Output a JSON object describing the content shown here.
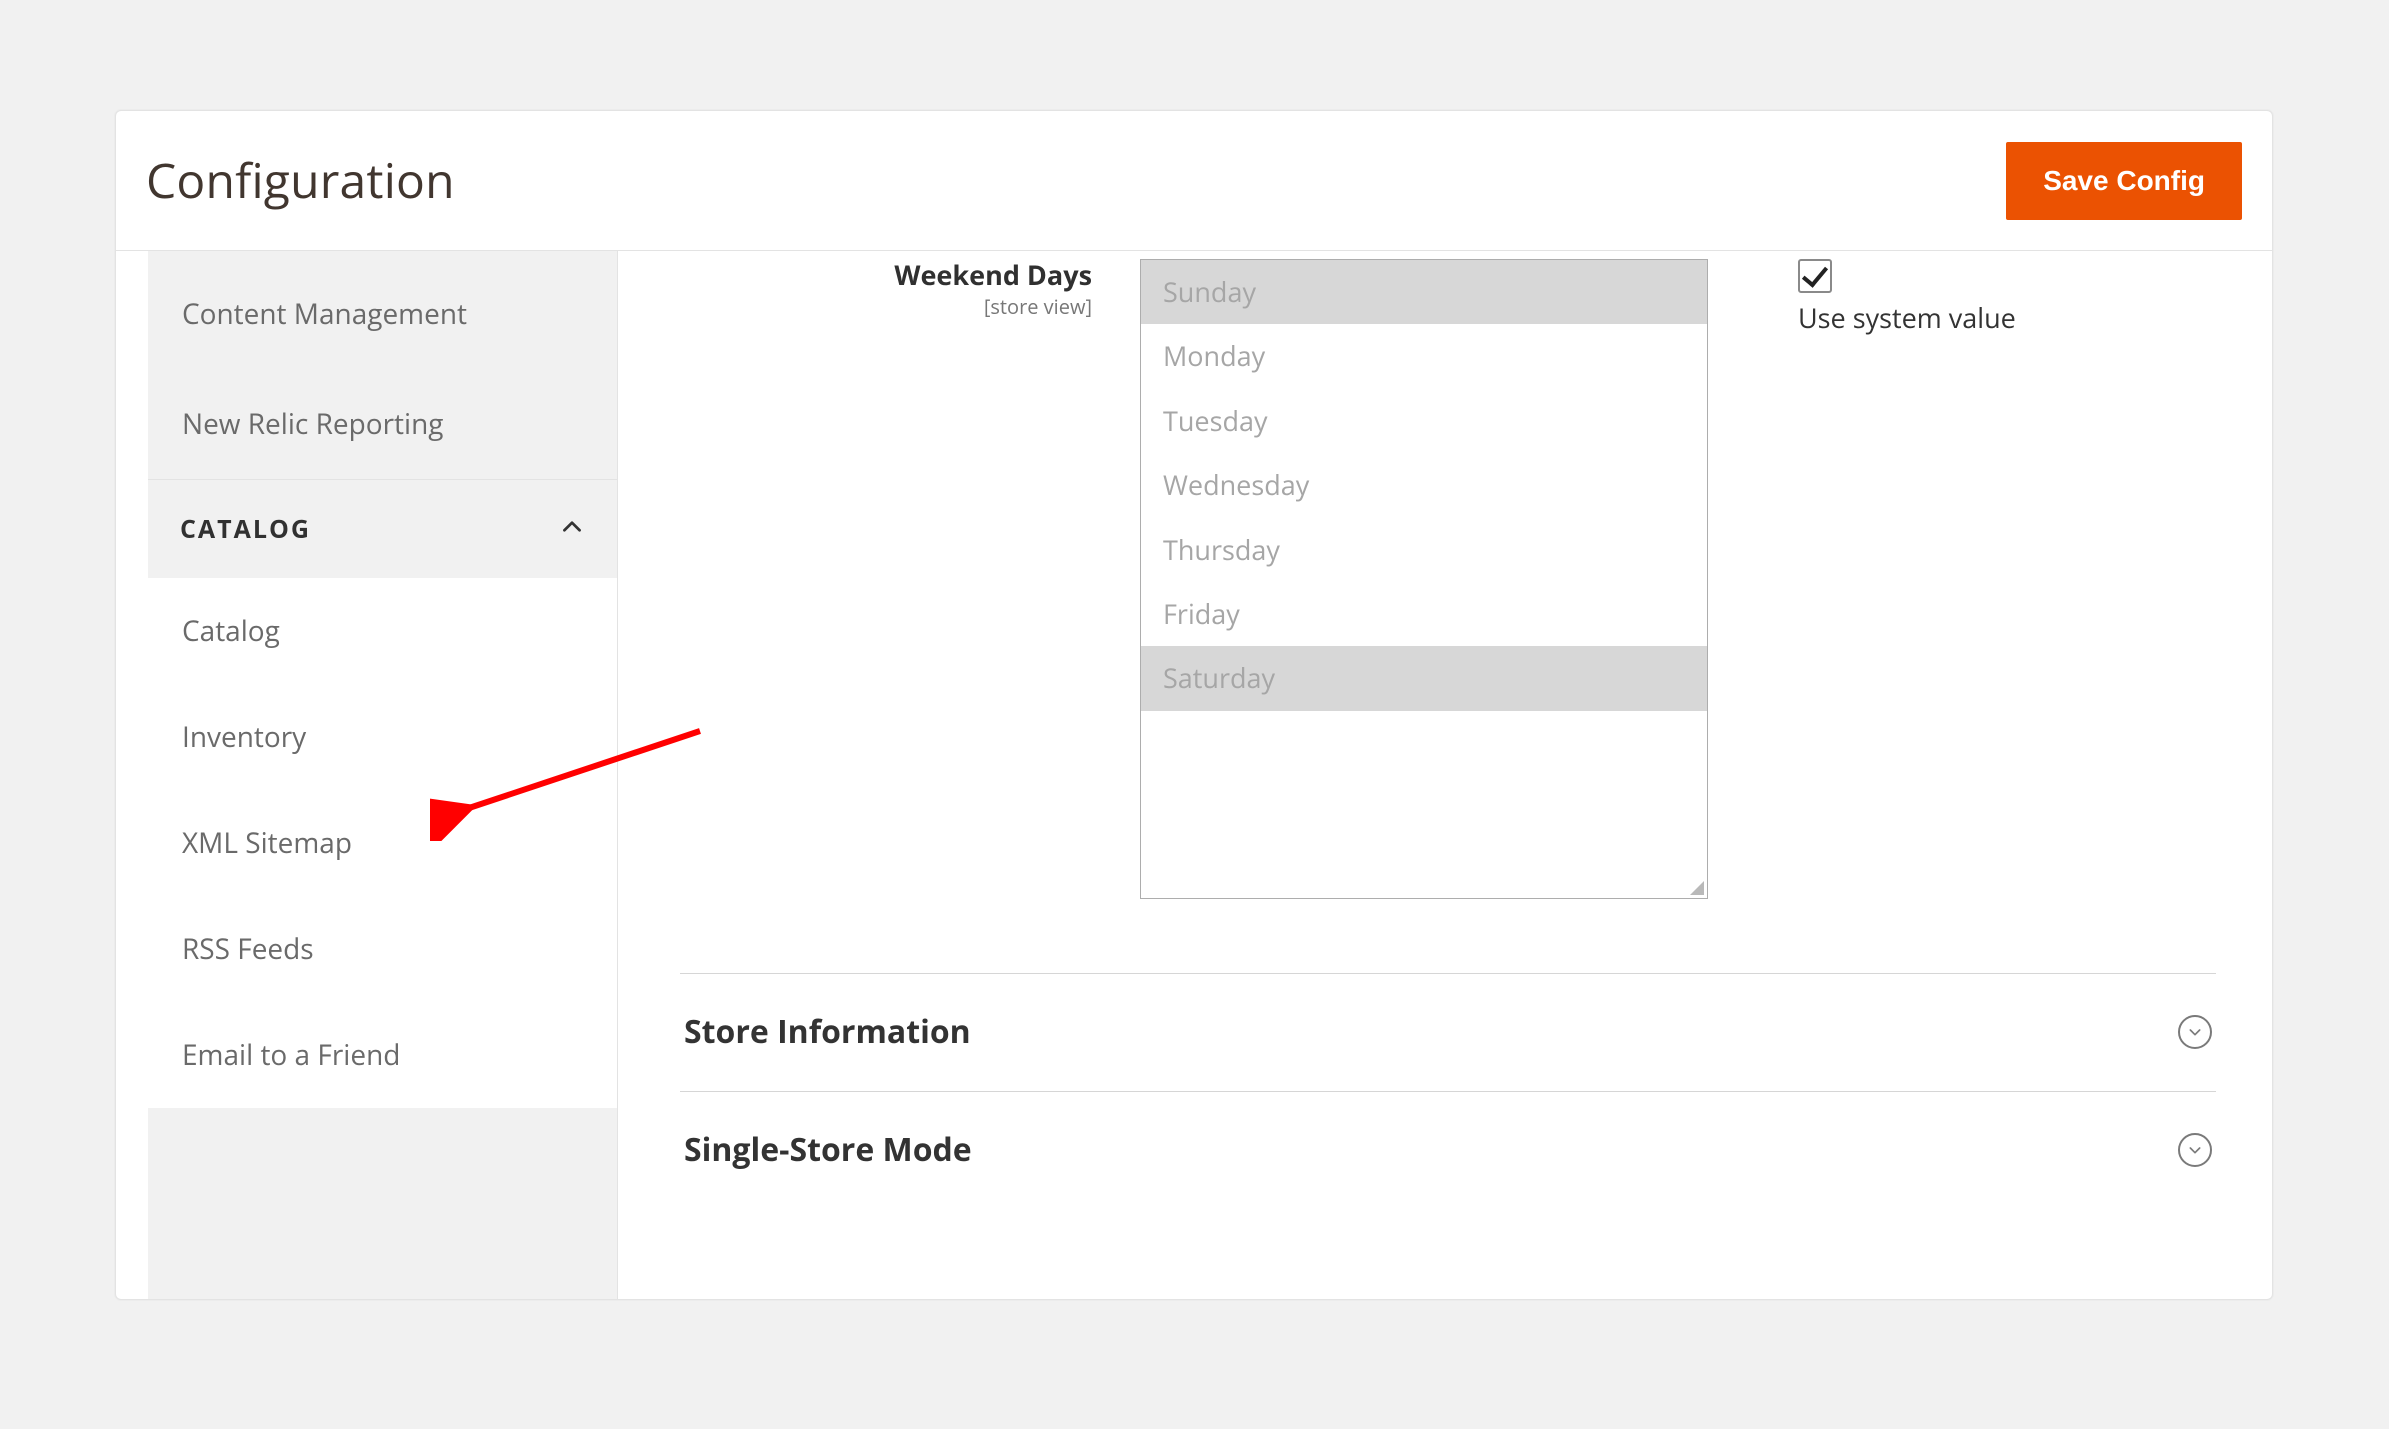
{
  "header": {
    "title": "Configuration",
    "save_label": "Save Config"
  },
  "sidebar": {
    "general_items": [
      {
        "label": "Content Management"
      },
      {
        "label": "New Relic Reporting"
      }
    ],
    "catalog_section": {
      "label": "CATALOG",
      "expanded": true,
      "items": [
        {
          "label": "Catalog"
        },
        {
          "label": "Inventory"
        },
        {
          "label": "XML Sitemap"
        },
        {
          "label": "RSS Feeds"
        },
        {
          "label": "Email to a Friend"
        }
      ]
    }
  },
  "field": {
    "label": "Weekend Days",
    "scope": "[store view]",
    "options": [
      {
        "label": "Sunday",
        "selected": true
      },
      {
        "label": "Monday",
        "selected": false
      },
      {
        "label": "Tuesday",
        "selected": false
      },
      {
        "label": "Wednesday",
        "selected": false
      },
      {
        "label": "Thursday",
        "selected": false
      },
      {
        "label": "Friday",
        "selected": false
      },
      {
        "label": "Saturday",
        "selected": true
      }
    ],
    "use_system": {
      "checked": true,
      "label": "Use system value"
    }
  },
  "accordions": [
    {
      "title": "Store Information"
    },
    {
      "title": "Single-Store Mode"
    }
  ]
}
